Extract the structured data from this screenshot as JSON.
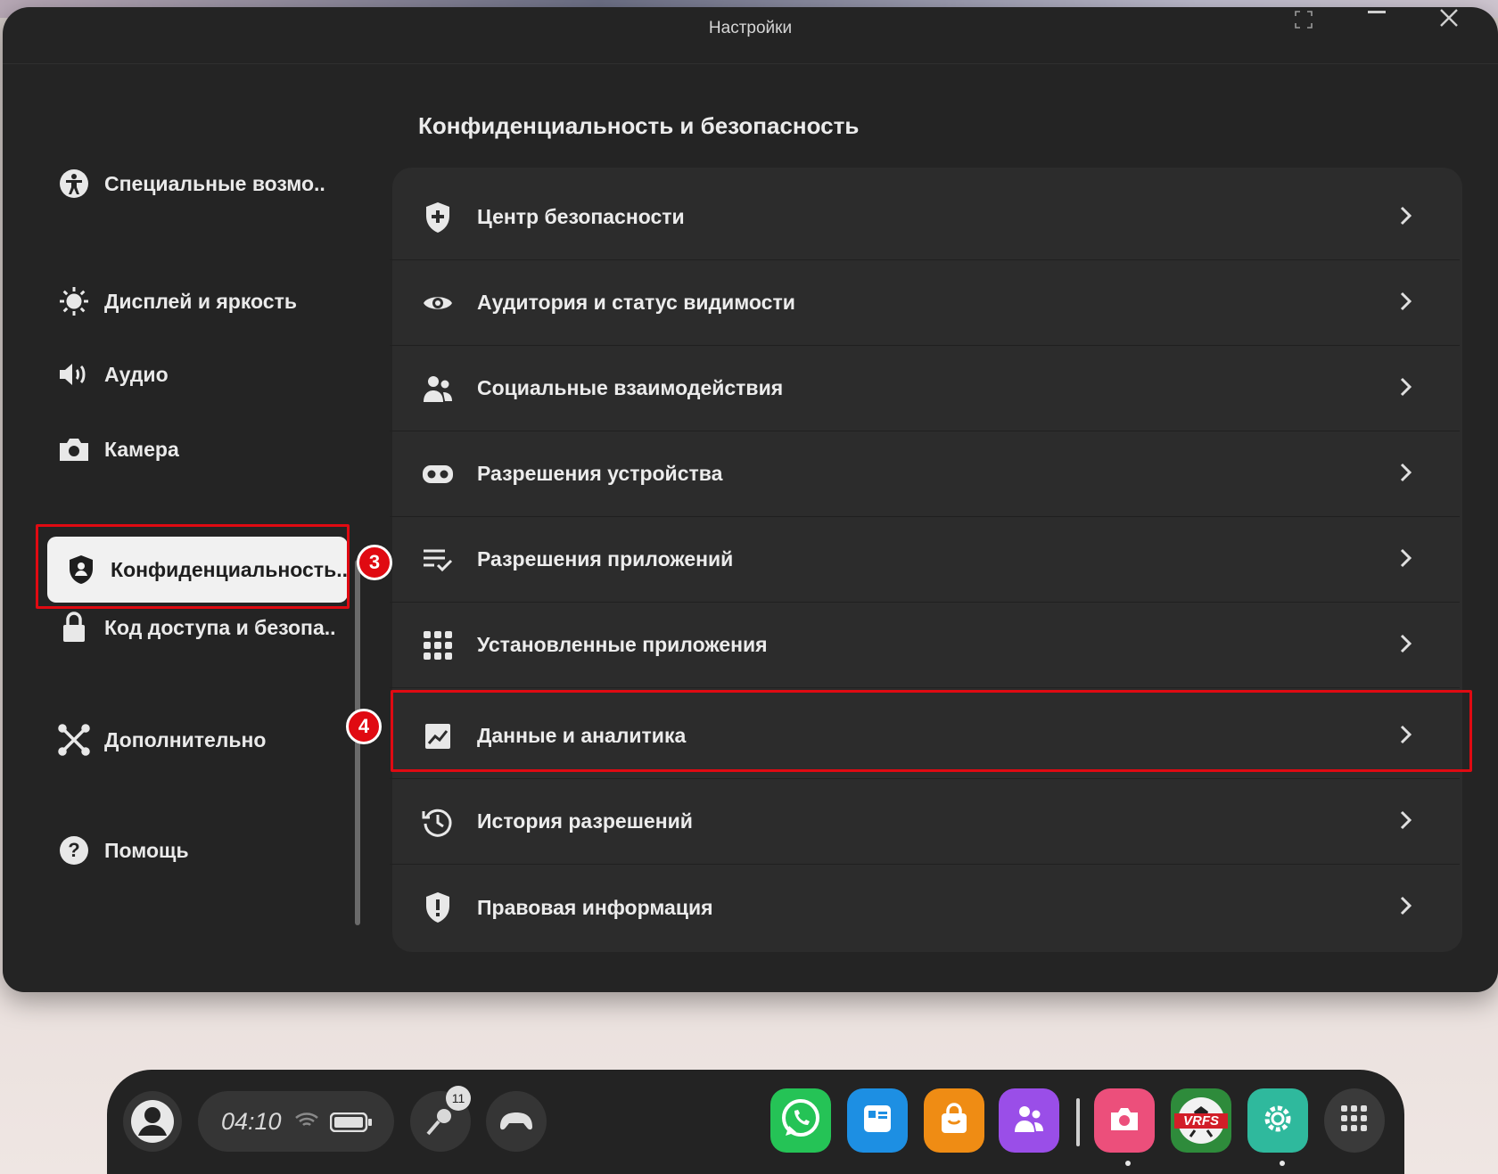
{
  "window": {
    "title": "Настройки"
  },
  "section": {
    "title": "Конфиденциальность и безопасность"
  },
  "sidebar": {
    "items": [
      {
        "label": "Специальные возмо..",
        "icon": "accessibility-icon"
      },
      {
        "label": "Дисплей и яркость",
        "icon": "brightness-icon"
      },
      {
        "label": "Аудио",
        "icon": "speaker-icon"
      },
      {
        "label": "Камера",
        "icon": "camera-icon"
      },
      {
        "label": "Конфиденциальность..",
        "icon": "privacy-shield-icon",
        "active": true
      },
      {
        "label": "Код доступа и безопа..",
        "icon": "lock-icon"
      },
      {
        "label": "Дополнительно",
        "icon": "advanced-icon"
      },
      {
        "label": "Помощь",
        "icon": "help-icon"
      }
    ]
  },
  "list": {
    "items": [
      {
        "label": "Центр безопасности",
        "icon": "shield-plus-icon"
      },
      {
        "label": "Аудитория и статус видимости",
        "icon": "eye-icon"
      },
      {
        "label": "Социальные взаимодействия",
        "icon": "people-icon"
      },
      {
        "label": "Разрешения устройства",
        "icon": "headset-icon"
      },
      {
        "label": "Разрешения приложений",
        "icon": "list-check-icon"
      },
      {
        "label": "Установленные приложения",
        "icon": "grid-icon"
      },
      {
        "label": "Данные и аналитика",
        "icon": "analytics-chart-icon"
      },
      {
        "label": "История разрешений",
        "icon": "history-icon"
      },
      {
        "label": "Правовая информация",
        "icon": "legal-shield-icon"
      }
    ]
  },
  "annotations": {
    "badge_3": "3",
    "badge_4": "4"
  },
  "taskbar": {
    "time": "04:10",
    "notification_count": "11",
    "apps": [
      "whatsapp-icon",
      "browser-icon",
      "store-icon",
      "people-app-icon",
      "camera-app-icon",
      "vrfs-game-icon",
      "settings-app-icon",
      "app-library-icon"
    ],
    "vrfs_label": "VRFS"
  },
  "colors": {
    "highlight": "#e00a12",
    "panel": "#242424",
    "list_bg": "#2c2c2c"
  }
}
